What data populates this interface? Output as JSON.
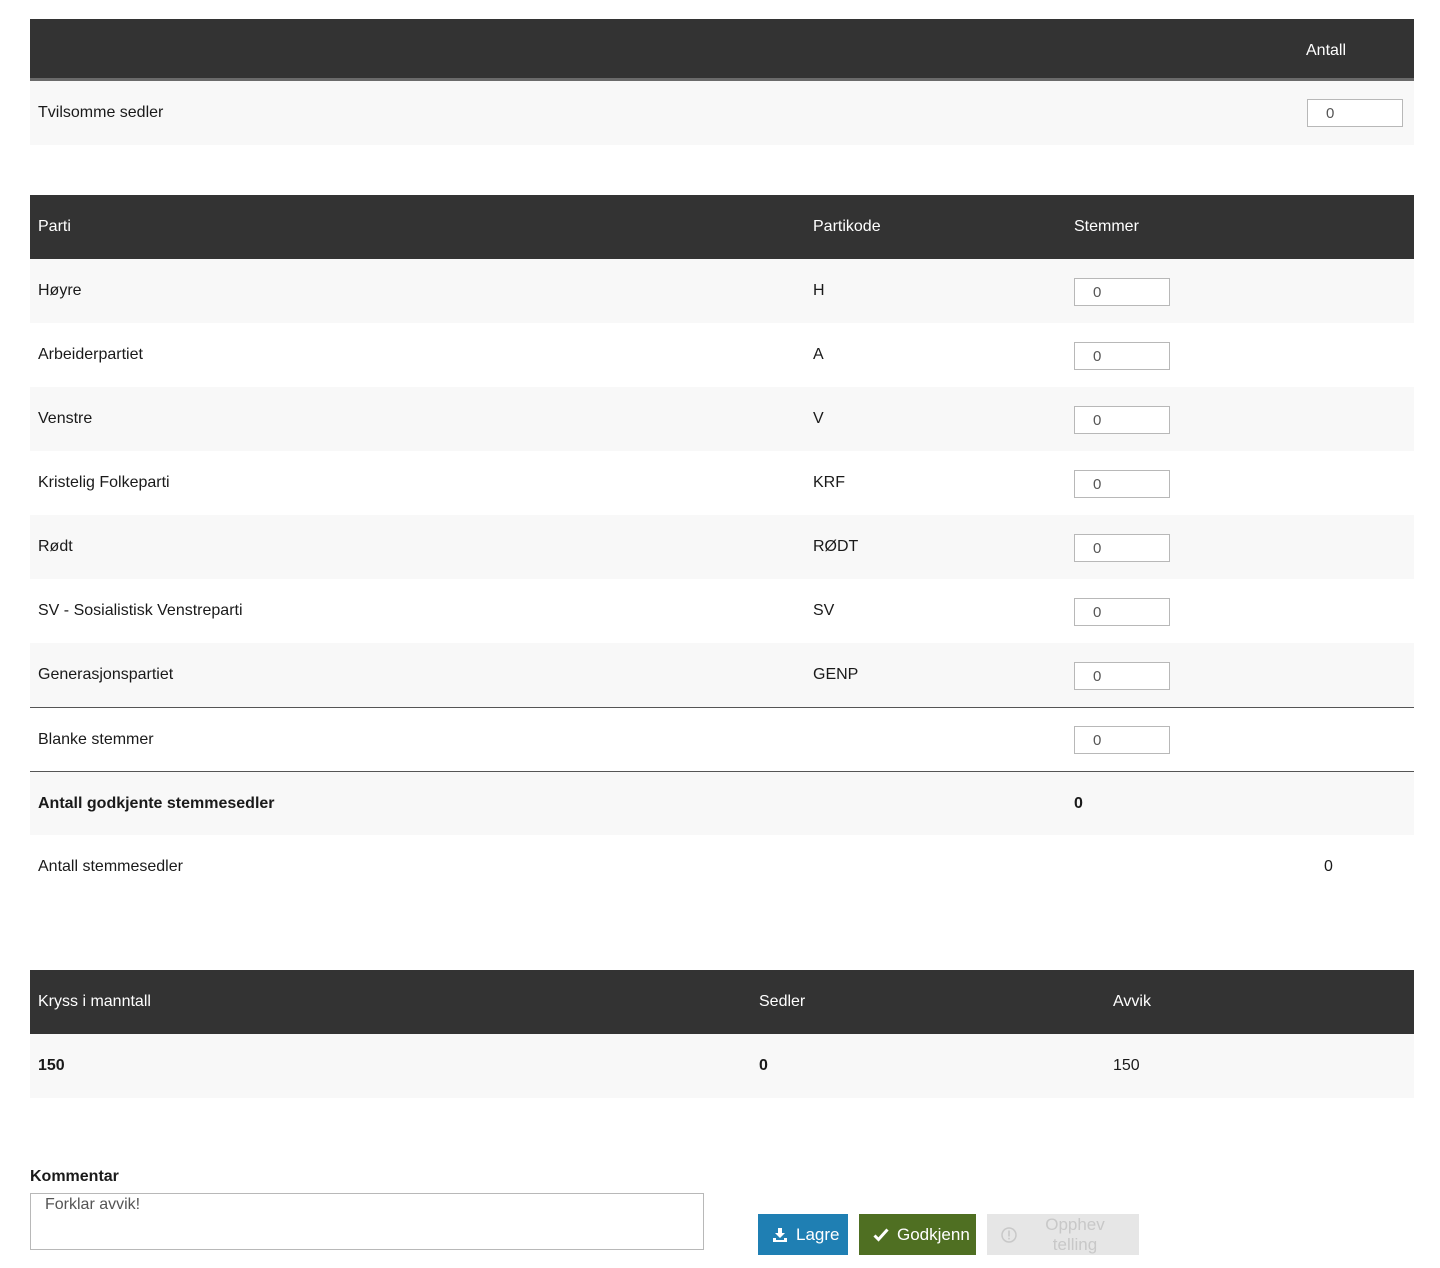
{
  "tvilsomme": {
    "header_antall": "Antall",
    "row_label": "Tvilsomme sedler",
    "row_value": "0"
  },
  "parti_table": {
    "headers": {
      "parti": "Parti",
      "partikode": "Partikode",
      "stemmer": "Stemmer"
    },
    "rows": [
      {
        "name": "Høyre",
        "code": "H",
        "votes": "0"
      },
      {
        "name": "Arbeiderpartiet",
        "code": "A",
        "votes": "0"
      },
      {
        "name": "Venstre",
        "code": "V",
        "votes": "0"
      },
      {
        "name": "Kristelig Folkeparti",
        "code": "KRF",
        "votes": "0"
      },
      {
        "name": "Rødt",
        "code": "RØDT",
        "votes": "0"
      },
      {
        "name": "SV - Sosialistisk Venstreparti",
        "code": "SV",
        "votes": "0"
      },
      {
        "name": "Generasjonspartiet",
        "code": "GENP",
        "votes": "0"
      }
    ],
    "blanke": {
      "label": "Blanke stemmer",
      "value": "0"
    },
    "godkjente": {
      "label": "Antall godkjente stemmesedler",
      "value": "0"
    },
    "stemmesedler": {
      "label": "Antall stemmesedler",
      "value": "0"
    }
  },
  "avvik_table": {
    "headers": {
      "kryss": "Kryss i manntall",
      "sedler": "Sedler",
      "avvik": "Avvik"
    },
    "row": {
      "kryss": "150",
      "sedler": "0",
      "avvik": "150"
    }
  },
  "kommentar": {
    "label": "Kommentar",
    "placeholder": "Forklar avvik!",
    "value": ""
  },
  "buttons": {
    "lagre": "Lagre",
    "godkjenn": "Godkjenn",
    "opphev": "Opphev telling"
  },
  "colors": {
    "header_bg": "#333333",
    "row_alt_bg": "#f8f8f8",
    "lagre_bg": "#1f7fb3",
    "godkjenn_bg": "#4f6f22",
    "opphev_bg": "#e6e6e6"
  },
  "icons": {
    "lagre": "save-download-icon",
    "godkjenn": "checkmark-icon",
    "opphev": "exclamation-circle-icon"
  }
}
